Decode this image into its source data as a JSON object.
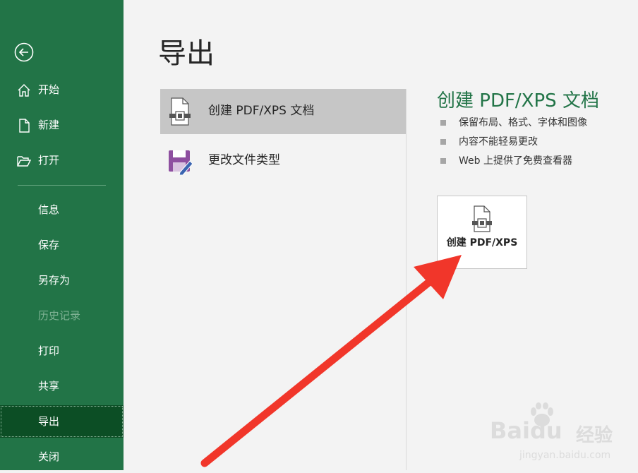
{
  "sidebar": {
    "items": [
      {
        "label": "开始",
        "icon": "home-icon"
      },
      {
        "label": "新建",
        "icon": "new-document-icon"
      },
      {
        "label": "打开",
        "icon": "folder-open-icon"
      },
      {
        "label": "信息"
      },
      {
        "label": "保存"
      },
      {
        "label": "另存为"
      },
      {
        "label": "历史记录",
        "disabled": true
      },
      {
        "label": "打印"
      },
      {
        "label": "共享"
      },
      {
        "label": "导出",
        "active": true
      },
      {
        "label": "关闭"
      }
    ]
  },
  "main": {
    "title": "导出",
    "options": [
      {
        "label": "创建 PDF/XPS 文档",
        "selected": true,
        "icon": "pdf-document-icon"
      },
      {
        "label": "更改文件类型",
        "icon": "change-file-type-icon"
      }
    ],
    "panel": {
      "title": "创建 PDF/XPS 文档",
      "bullets": [
        "保留布局、格式、字体和图像",
        "内容不能轻易更改",
        "Web 上提供了免费查看器"
      ],
      "button_label": "创建 PDF/XPS"
    }
  },
  "watermark": {
    "brand": "Baidu",
    "subbrand": "经验",
    "url": "jingyan.baidu.com"
  },
  "colors": {
    "sidebar": "#227447",
    "sidebar_active": "#0c4e25",
    "accent": "#227447",
    "arrow": "#f1362a"
  }
}
